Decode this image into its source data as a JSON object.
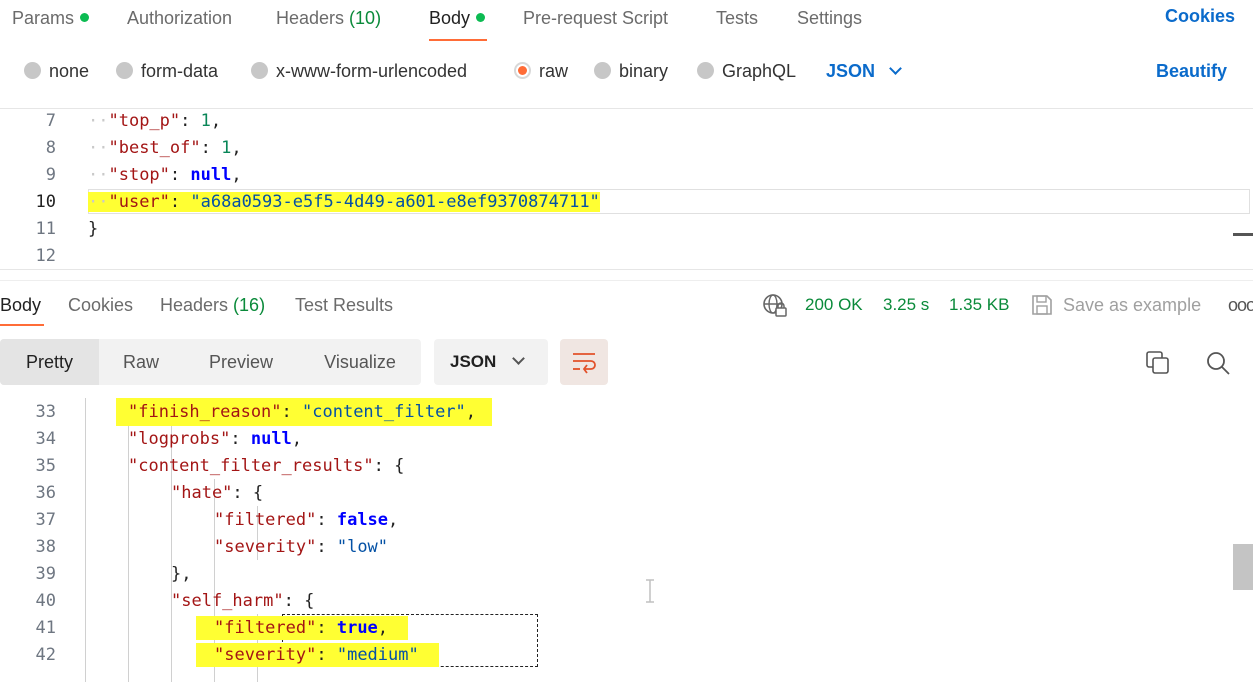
{
  "request_tabs": [
    {
      "label": "Params",
      "count": "",
      "dot": true,
      "active": false
    },
    {
      "label": "Authorization",
      "count": "",
      "dot": false,
      "active": false
    },
    {
      "label": "Headers ",
      "count": "(10)",
      "dot": false,
      "active": false
    },
    {
      "label": "Body",
      "count": "",
      "dot": true,
      "active": true
    },
    {
      "label": "Pre-request Script",
      "count": "",
      "dot": false,
      "active": false
    },
    {
      "label": "Tests",
      "count": "",
      "dot": false,
      "active": false
    },
    {
      "label": "Settings",
      "count": "",
      "dot": false,
      "active": false
    }
  ],
  "cookies_label": "Cookies",
  "body_types": [
    {
      "label": "none",
      "checked": false
    },
    {
      "label": "form-data",
      "checked": false
    },
    {
      "label": "x-www-form-urlencoded",
      "checked": false
    },
    {
      "label": "raw",
      "checked": true
    },
    {
      "label": "binary",
      "checked": false
    },
    {
      "label": "GraphQL",
      "checked": false
    }
  ],
  "raw_language": "JSON",
  "beautify_label": "Beautify",
  "request_code": [
    {
      "n": "7",
      "pre": "··",
      "key": "\"top_p\"",
      "sep": ": ",
      "val": "1",
      "vtype": "num",
      "end": ","
    },
    {
      "n": "8",
      "pre": "··",
      "key": "\"best_of\"",
      "sep": ": ",
      "val": "1",
      "vtype": "num",
      "end": ","
    },
    {
      "n": "9",
      "pre": "··",
      "key": "\"stop\"",
      "sep": ": ",
      "val": "null",
      "vtype": "kw",
      "end": ","
    },
    {
      "n": "10",
      "pre": "··",
      "key": "\"user\"",
      "sep": ": ",
      "val": "\"a68a0593-e5f5-4d49-a601-e8ef9370874711\"",
      "vtype": "str",
      "end": ""
    },
    {
      "n": "11",
      "pre": "",
      "key": "",
      "sep": "",
      "val": "}",
      "vtype": "plain",
      "end": ""
    },
    {
      "n": "12",
      "pre": "",
      "key": "",
      "sep": "",
      "val": "",
      "vtype": "plain",
      "end": ""
    }
  ],
  "response_tabs": [
    {
      "label": "Body",
      "count": "",
      "active": true
    },
    {
      "label": "Cookies",
      "count": "",
      "active": false
    },
    {
      "label": "Headers ",
      "count": "(16)",
      "active": false
    },
    {
      "label": "Test Results",
      "count": "",
      "active": false
    }
  ],
  "status": {
    "code": "200 OK",
    "time": "3.25 s",
    "size": "1.35 KB"
  },
  "save_as_example_label": "Save as example",
  "more_label": "ooo",
  "view_modes": [
    "Pretty",
    "Raw",
    "Preview",
    "Visualize"
  ],
  "response_format": "JSON",
  "response_code": [
    {
      "n": "33",
      "indent": 2,
      "key": "\"finish_reason\"",
      "sep": ": ",
      "val": "\"content_filter\"",
      "vtype": "str",
      "end": ","
    },
    {
      "n": "34",
      "indent": 2,
      "key": "\"logprobs\"",
      "sep": ": ",
      "val": "null",
      "vtype": "kw",
      "end": ","
    },
    {
      "n": "35",
      "indent": 2,
      "key": "\"content_filter_results\"",
      "sep": ": ",
      "val": "{",
      "vtype": "plain",
      "end": ""
    },
    {
      "n": "36",
      "indent": 3,
      "key": "\"hate\"",
      "sep": ": ",
      "val": "{",
      "vtype": "plain",
      "end": ""
    },
    {
      "n": "37",
      "indent": 4,
      "key": "\"filtered\"",
      "sep": ": ",
      "val": "false",
      "vtype": "kw",
      "end": ","
    },
    {
      "n": "38",
      "indent": 4,
      "key": "\"severity\"",
      "sep": ": ",
      "val": "\"low\"",
      "vtype": "str",
      "end": ""
    },
    {
      "n": "39",
      "indent": 3,
      "key": "",
      "sep": "",
      "val": "},",
      "vtype": "plain",
      "end": ""
    },
    {
      "n": "40",
      "indent": 3,
      "key": "\"self_harm\"",
      "sep": ": ",
      "val": "{",
      "vtype": "plain",
      "end": ""
    },
    {
      "n": "41",
      "indent": 4,
      "key": "\"filtered\"",
      "sep": ": ",
      "val": "true",
      "vtype": "kw",
      "end": ","
    },
    {
      "n": "42",
      "indent": 4,
      "key": "\"severity\"",
      "sep": ": ",
      "val": "\"medium\"",
      "vtype": "str",
      "end": ""
    }
  ],
  "colors": {
    "accent": "#ff6c37",
    "link": "#0b6bcb",
    "success": "#0a8a3a",
    "highlight": "#ffff33"
  },
  "icons": {
    "status_globe": "globe-lock-icon",
    "save": "save-icon",
    "wrap": "wrap-lines-icon",
    "copy": "copy-icon",
    "search": "search-icon"
  }
}
